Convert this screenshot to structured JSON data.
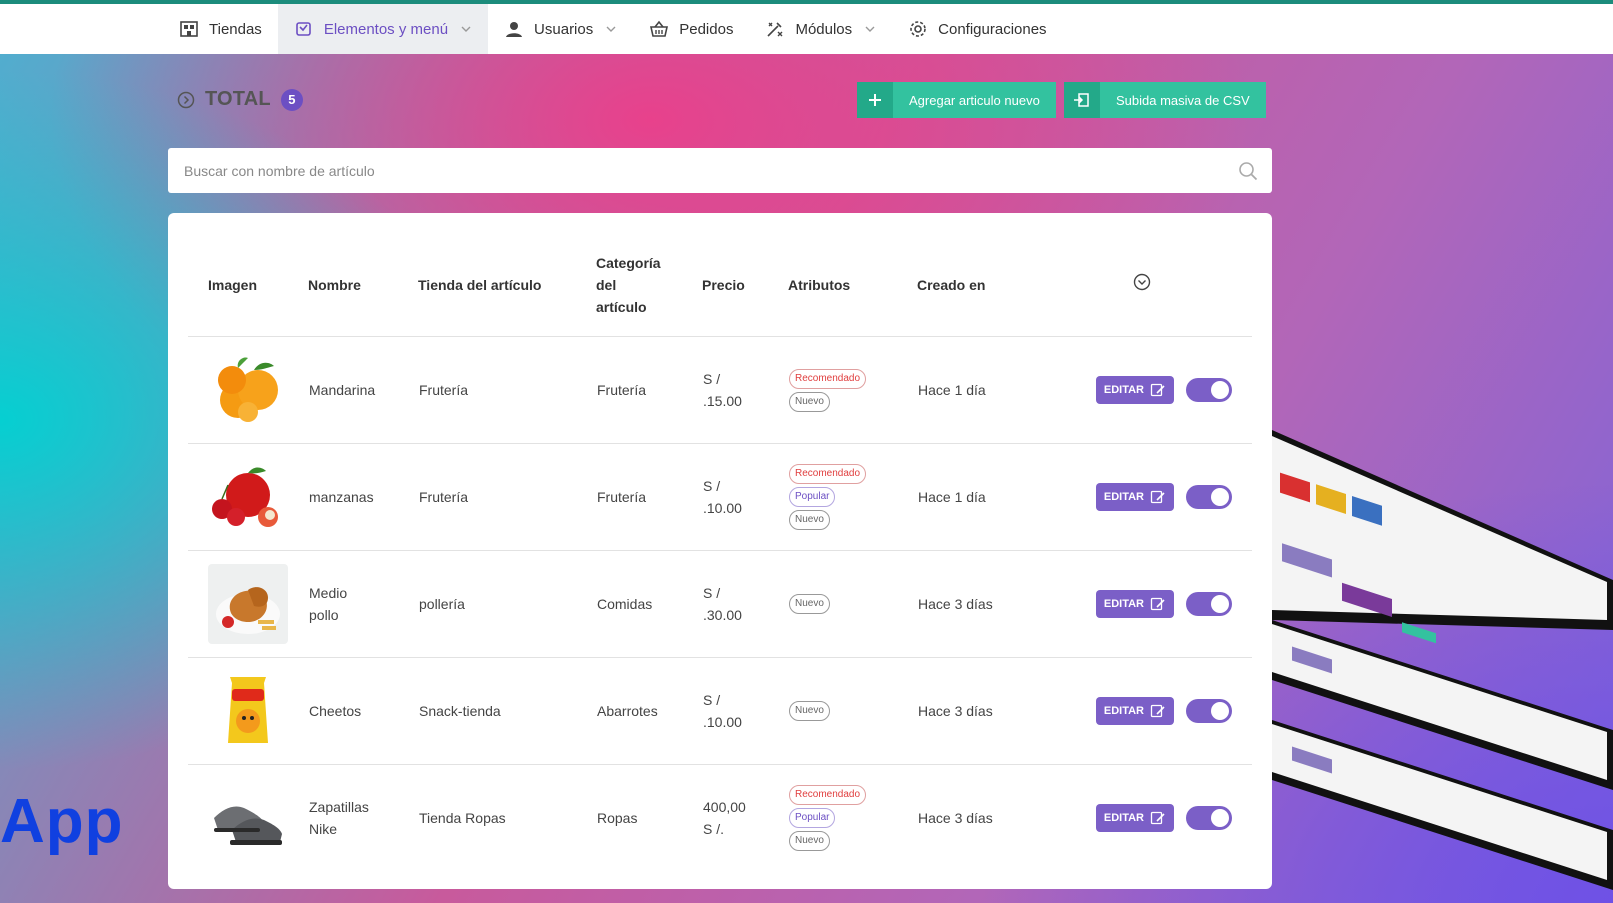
{
  "nav": {
    "items": [
      {
        "label": "Tiendas",
        "icon": "store-icon",
        "active": false,
        "dropdown": false
      },
      {
        "label": "Elementos y menú",
        "icon": "menu-book-icon",
        "active": true,
        "dropdown": true
      },
      {
        "label": "Usuarios",
        "icon": "user-icon",
        "active": false,
        "dropdown": true
      },
      {
        "label": "Pedidos",
        "icon": "basket-icon",
        "active": false,
        "dropdown": false
      },
      {
        "label": "Módulos",
        "icon": "modules-icon",
        "active": false,
        "dropdown": true
      },
      {
        "label": "Configuraciones",
        "icon": "gear-icon",
        "active": false,
        "dropdown": false
      }
    ]
  },
  "header": {
    "total_label": "TOTAL",
    "total_count": "5",
    "add_button": "Agregar articulo nuevo",
    "csv_button": "Subida masiva de CSV"
  },
  "search": {
    "placeholder": "Buscar con nombre de artículo"
  },
  "table": {
    "columns": [
      "Imagen",
      "Nombre",
      "Tienda del artículo",
      "Categoría del artículo",
      "Precio",
      "Atributos",
      "Creado en"
    ],
    "edit_label": "EDITAR",
    "rows": [
      {
        "name": "Mandarina",
        "store": "Frutería",
        "category": "Frutería",
        "price": "S / .15.00",
        "attributes": [
          "Recomendado",
          "Nuevo"
        ],
        "created": "Hace 1 día",
        "enabled": true,
        "image": "mandarina"
      },
      {
        "name": "manzanas",
        "store": "Frutería",
        "category": "Frutería",
        "price": "S / .10.00",
        "attributes": [
          "Recomendado",
          "Popular",
          "Nuevo"
        ],
        "created": "Hace 1 día",
        "enabled": true,
        "image": "manzanas"
      },
      {
        "name": "Medio pollo",
        "store": "pollería",
        "category": "Comidas",
        "price": "S / .30.00",
        "attributes": [
          "Nuevo"
        ],
        "created": "Hace 3 días",
        "enabled": true,
        "image": "pollo"
      },
      {
        "name": "Cheetos",
        "store": "Snack-tienda",
        "category": "Abarrotes",
        "price": "S / .10.00",
        "attributes": [
          "Nuevo"
        ],
        "created": "Hace 3 días",
        "enabled": true,
        "image": "cheetos"
      },
      {
        "name": "Zapatillas Nike",
        "store": "Tienda Ropas",
        "category": "Ropas",
        "price": "400,00 S /.",
        "attributes": [
          "Recomendado",
          "Popular",
          "Nuevo"
        ],
        "created": "Hace 3 días",
        "enabled": true,
        "image": "zapatillas"
      }
    ]
  },
  "watermark": {
    "text": "App"
  },
  "colors": {
    "accent": "#6c4fc3",
    "button_green": "#33c29f",
    "topbar_border": "#1c8c7c"
  }
}
